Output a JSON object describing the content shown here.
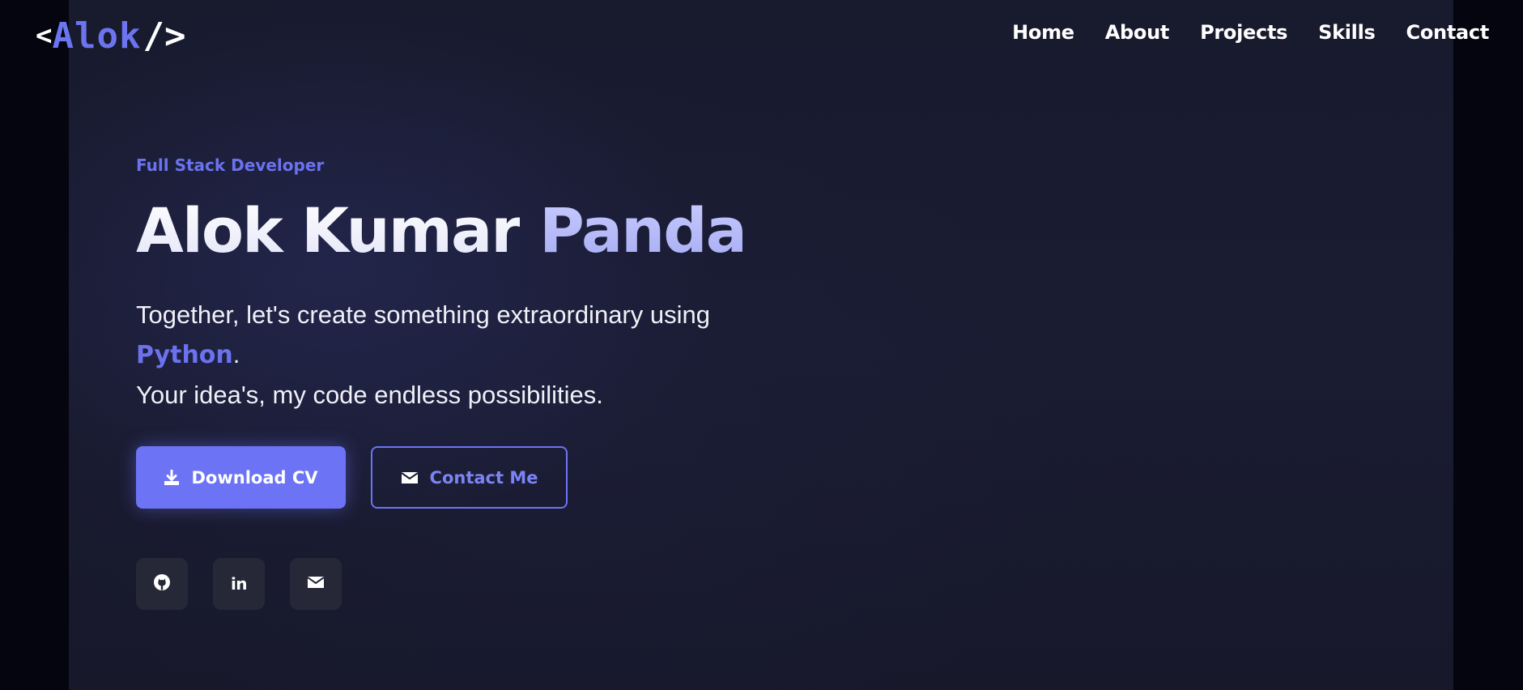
{
  "logo": {
    "open_bracket": "<",
    "name": "Alok",
    "close_bracket": "/>"
  },
  "nav": {
    "items": [
      {
        "label": "Home"
      },
      {
        "label": "About"
      },
      {
        "label": "Projects"
      },
      {
        "label": "Skills"
      },
      {
        "label": "Contact"
      }
    ]
  },
  "hero": {
    "role": "Full Stack Developer",
    "first_name": "Alok Kumar",
    "last_name": "Panda",
    "tagline_line1": "Together, let's create something extraordinary using",
    "tech": "Python",
    "tech_suffix": ".",
    "tagline_line3": "Your idea's, my code endless possibilities."
  },
  "buttons": {
    "download_cv": {
      "label": "Download CV",
      "icon": "download-icon"
    },
    "contact_me": {
      "label": "Contact Me",
      "icon": "envelope-icon"
    }
  },
  "socials": [
    {
      "icon": "github-icon"
    },
    {
      "icon": "linkedin-icon",
      "glyph": "in"
    },
    {
      "icon": "envelope-icon"
    }
  ],
  "colors": {
    "accent": "#6c74f5",
    "background": "#181a2e",
    "outer_background": "#05050f",
    "heading_light": "#ffffff",
    "heading_accent": "#b6bbf8",
    "social_bg": "#262838"
  }
}
